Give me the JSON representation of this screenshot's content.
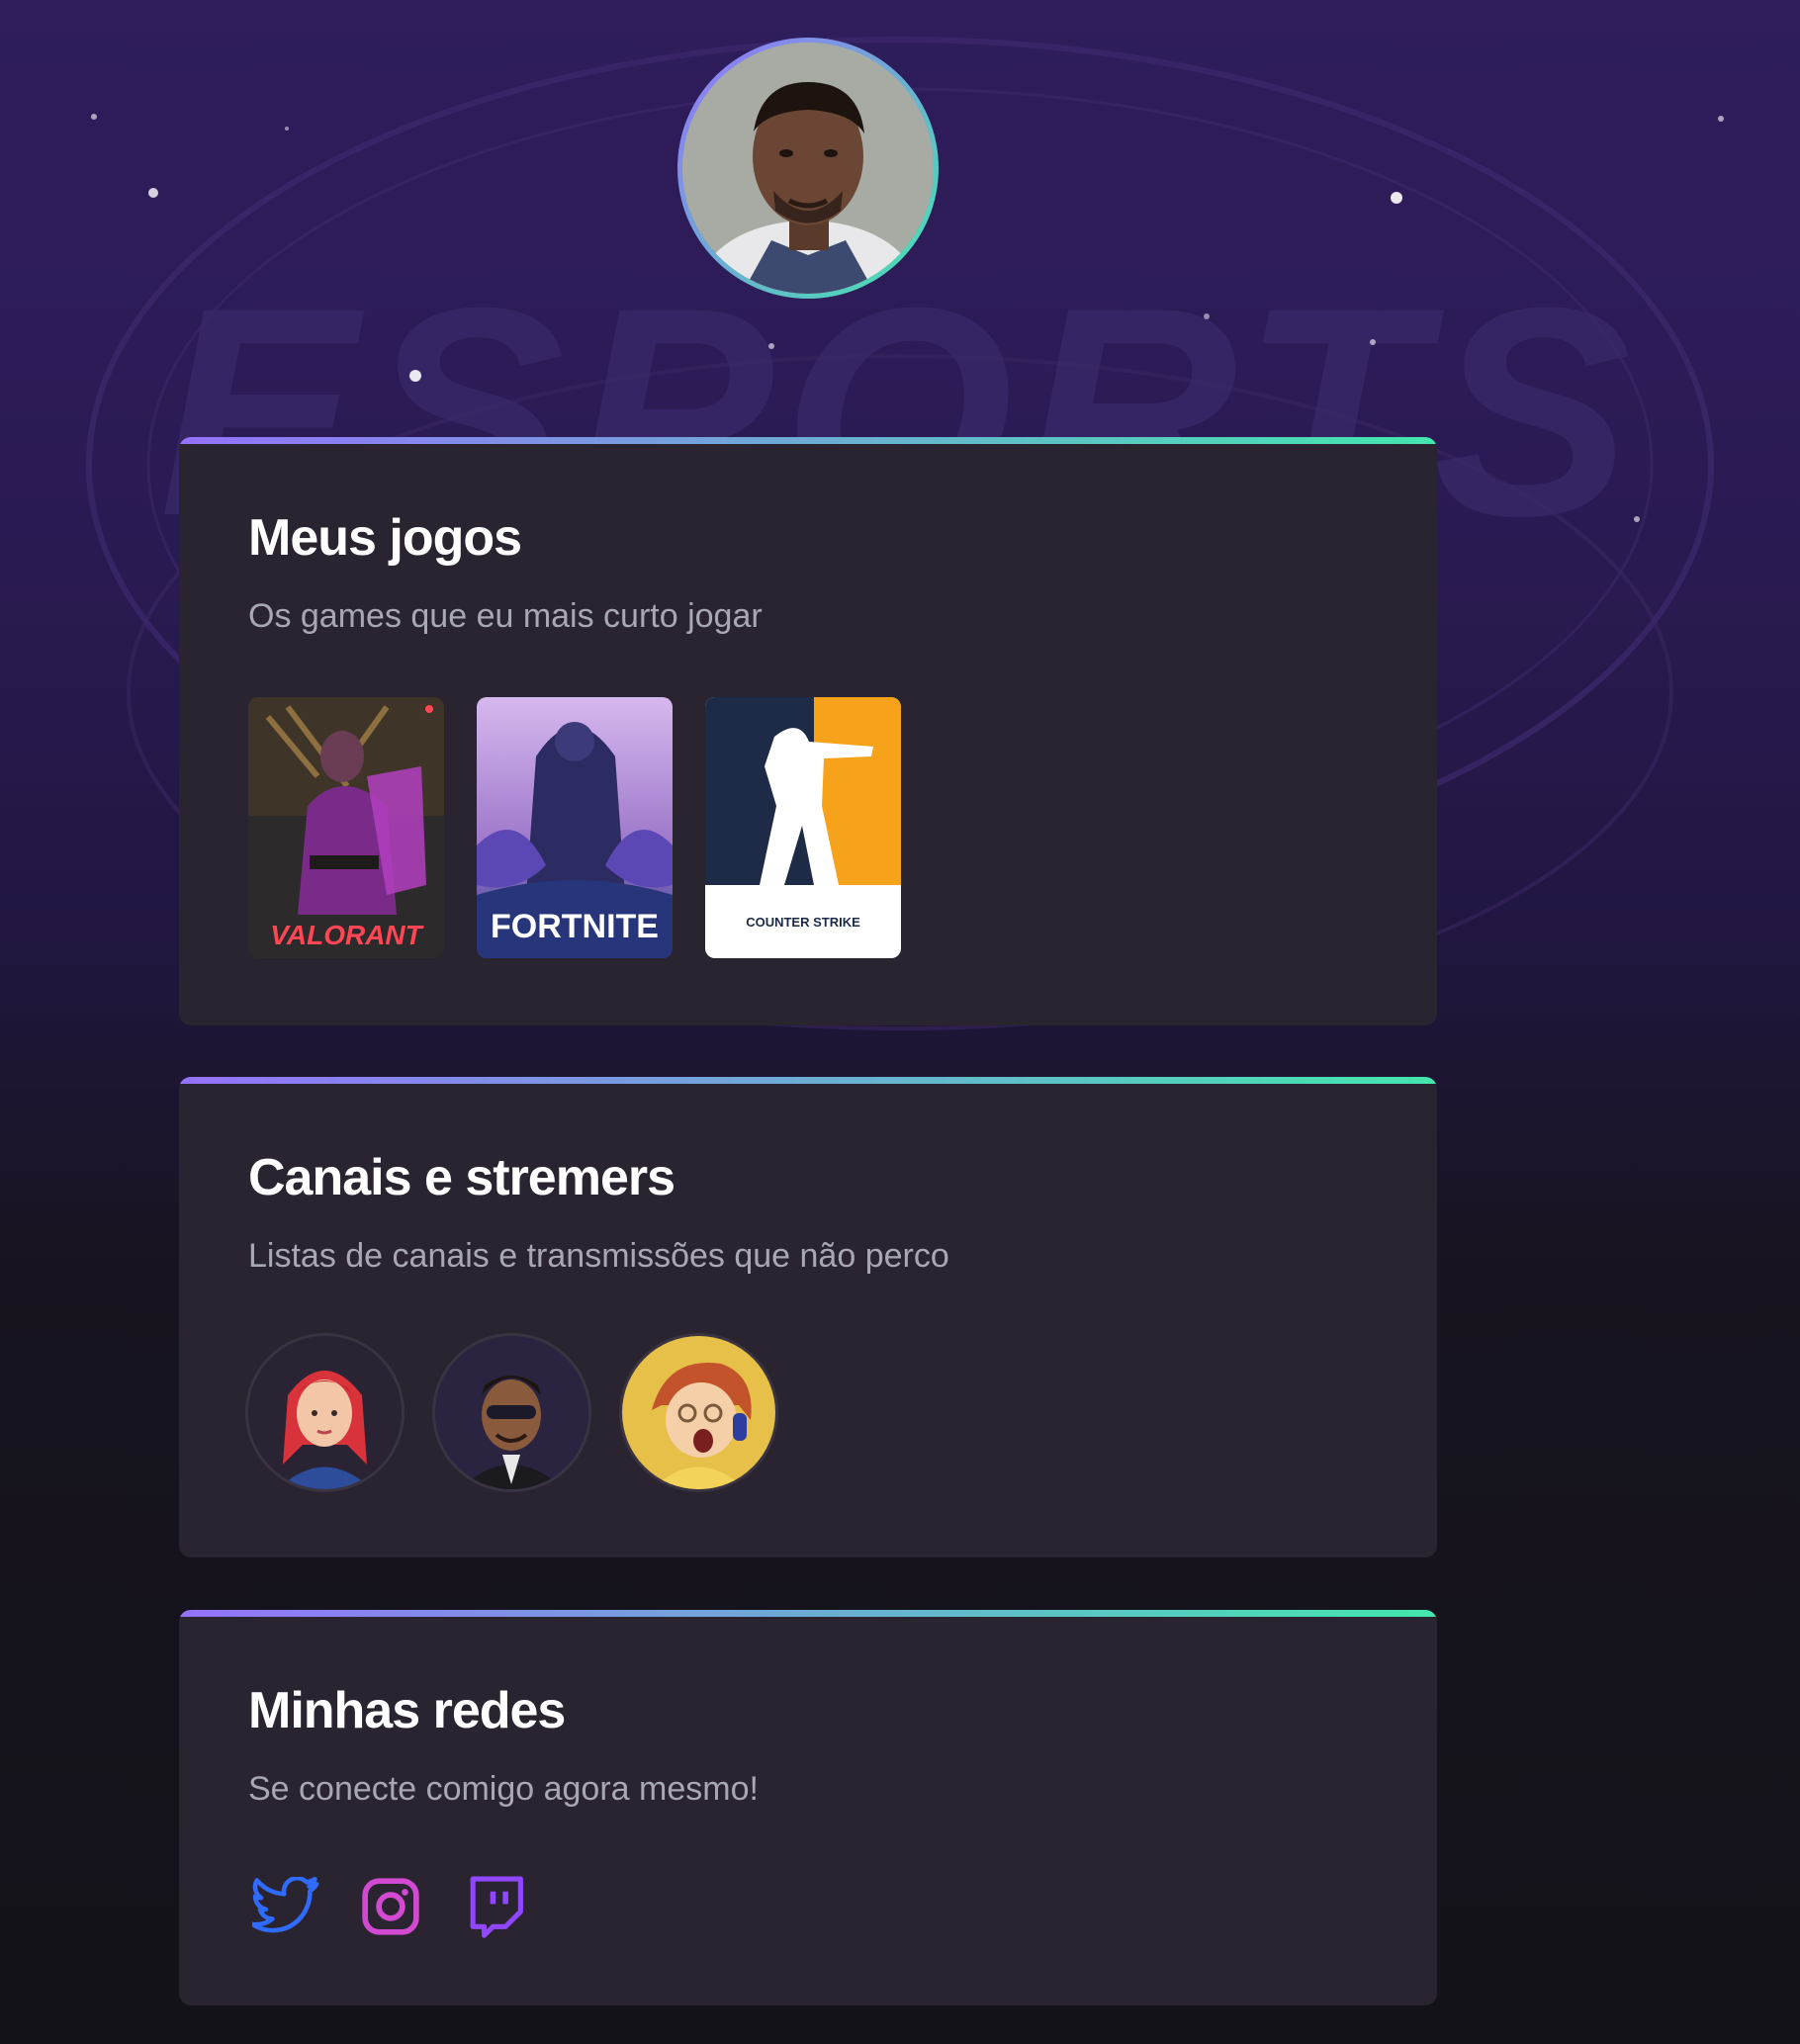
{
  "profile": {
    "avatar_alt": "profile-photo"
  },
  "background": {
    "wordmark": "ESPORTS"
  },
  "games_section": {
    "title": "Meus jogos",
    "subtitle": "Os games que eu mais curto jogar",
    "games": [
      {
        "name": "VALORANT"
      },
      {
        "name": "FORTNITE"
      },
      {
        "name": "COUNTER STRIKE"
      }
    ]
  },
  "streams_section": {
    "title": "Canais e stremers",
    "subtitle": "Listas de canais e transmissões que não perco"
  },
  "social_section": {
    "title": "Minhas redes",
    "subtitle": "Se conecte comigo agora mesmo!",
    "networks": [
      "twitter-icon",
      "instagram-icon",
      "twitch-icon"
    ]
  },
  "colors": {
    "gradient_start": "#9572fc",
    "gradient_end": "#43e7ad",
    "card_bg": "#29242f",
    "twitter": "#2f6bff",
    "instagram": "#d14ad1",
    "twitch": "#9146ff"
  }
}
